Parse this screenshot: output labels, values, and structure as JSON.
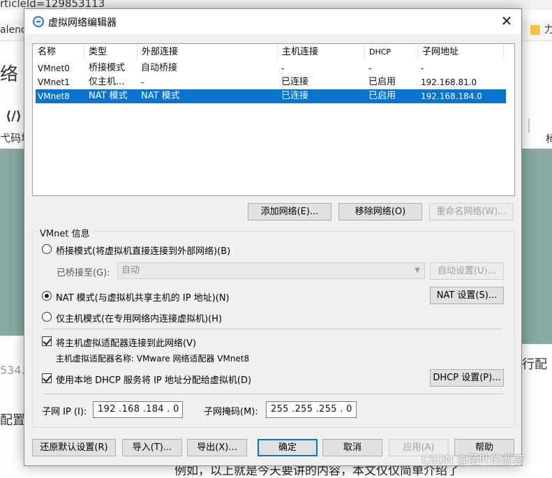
{
  "background": {
    "url_fragment": "rticleId=129853113",
    "tab_fragment": "alend",
    "folder_text": "力",
    "heading_fragment": "络",
    "code_icon": "⟨/⟩",
    "code_label": "弋码块",
    "right_label": "椅",
    "number_fragment": "534.",
    "left_text_fragment": "配置",
    "right_text_fragment": "行配",
    "bottom_text": "例如，以上就是今天要讲的内容，本文仅仅简单介绍了",
    "watermark": "CSDN @落叶的悲哀"
  },
  "dialog": {
    "title": "虚拟网络编辑器",
    "close_glyph": "✕"
  },
  "network_list": {
    "columns": [
      "名称",
      "类型",
      "外部连接",
      "主机连接",
      "DHCP",
      "子网地址"
    ],
    "rows": [
      {
        "name": "VMnet0",
        "type": "桥接模式",
        "external": "自动桥接",
        "host": "-",
        "dhcp": "-",
        "subnet": "-",
        "selected": false
      },
      {
        "name": "VMnet1",
        "type": "仅主机...",
        "external": "-",
        "host": "已连接",
        "dhcp": "已启用",
        "subnet": "192.168.81.0",
        "selected": false
      },
      {
        "name": "VMnet8",
        "type": "NAT 模式",
        "external": "NAT 模式",
        "host": "已连接",
        "dhcp": "已启用",
        "subnet": "192.168.184.0",
        "selected": true
      }
    ]
  },
  "list_buttons": {
    "add": "添加网络(E)...",
    "remove": "移除网络(O)",
    "rename": "重命名网络(W)..."
  },
  "vmnet_info": {
    "group_label": "VMnet 信息",
    "bridged_label": "桥接模式(将虚拟机直接连接到外部网络)(B)",
    "bridged_to_label": "已桥接至(G):",
    "bridged_to_value": "自动",
    "auto_settings": "自动设置(U)...",
    "nat_label": "NAT 模式(与虚拟机共享主机的 IP 地址)(N)",
    "nat_settings": "NAT 设置(S)...",
    "hostonly_label": "仅主机模式(在专用网络内连接虚拟机)(H)",
    "connect_adapter_label": "将主机虚拟适配器连接到此网络(V)",
    "adapter_name_label": "主机虚拟适配器名称: VMware 网络适配器 VMnet8",
    "dhcp_label": "使用本地 DHCP 服务将 IP 地址分配给虚拟机(D)",
    "dhcp_settings": "DHCP 设置(P)...",
    "subnet_ip_label": "子网 IP (I):",
    "subnet_ip_value": "192 .168 .184 .  0",
    "subnet_mask_label": "子网掩码(M):",
    "subnet_mask_value": "255 .255 .255 .  0",
    "mode": "nat",
    "connect_adapter_checked": true,
    "dhcp_checked": true
  },
  "footer_buttons": {
    "restore": "还原默认设置(R)",
    "import": "导入(T)...",
    "export": "导出(X)...",
    "ok": "确定",
    "cancel": "取消",
    "apply": "应用(A)",
    "help": "帮助"
  },
  "colors": {
    "selection": "#0a73d0",
    "dialog_bg": "#f0f0f0",
    "teal_bg": "#86a9a3"
  }
}
